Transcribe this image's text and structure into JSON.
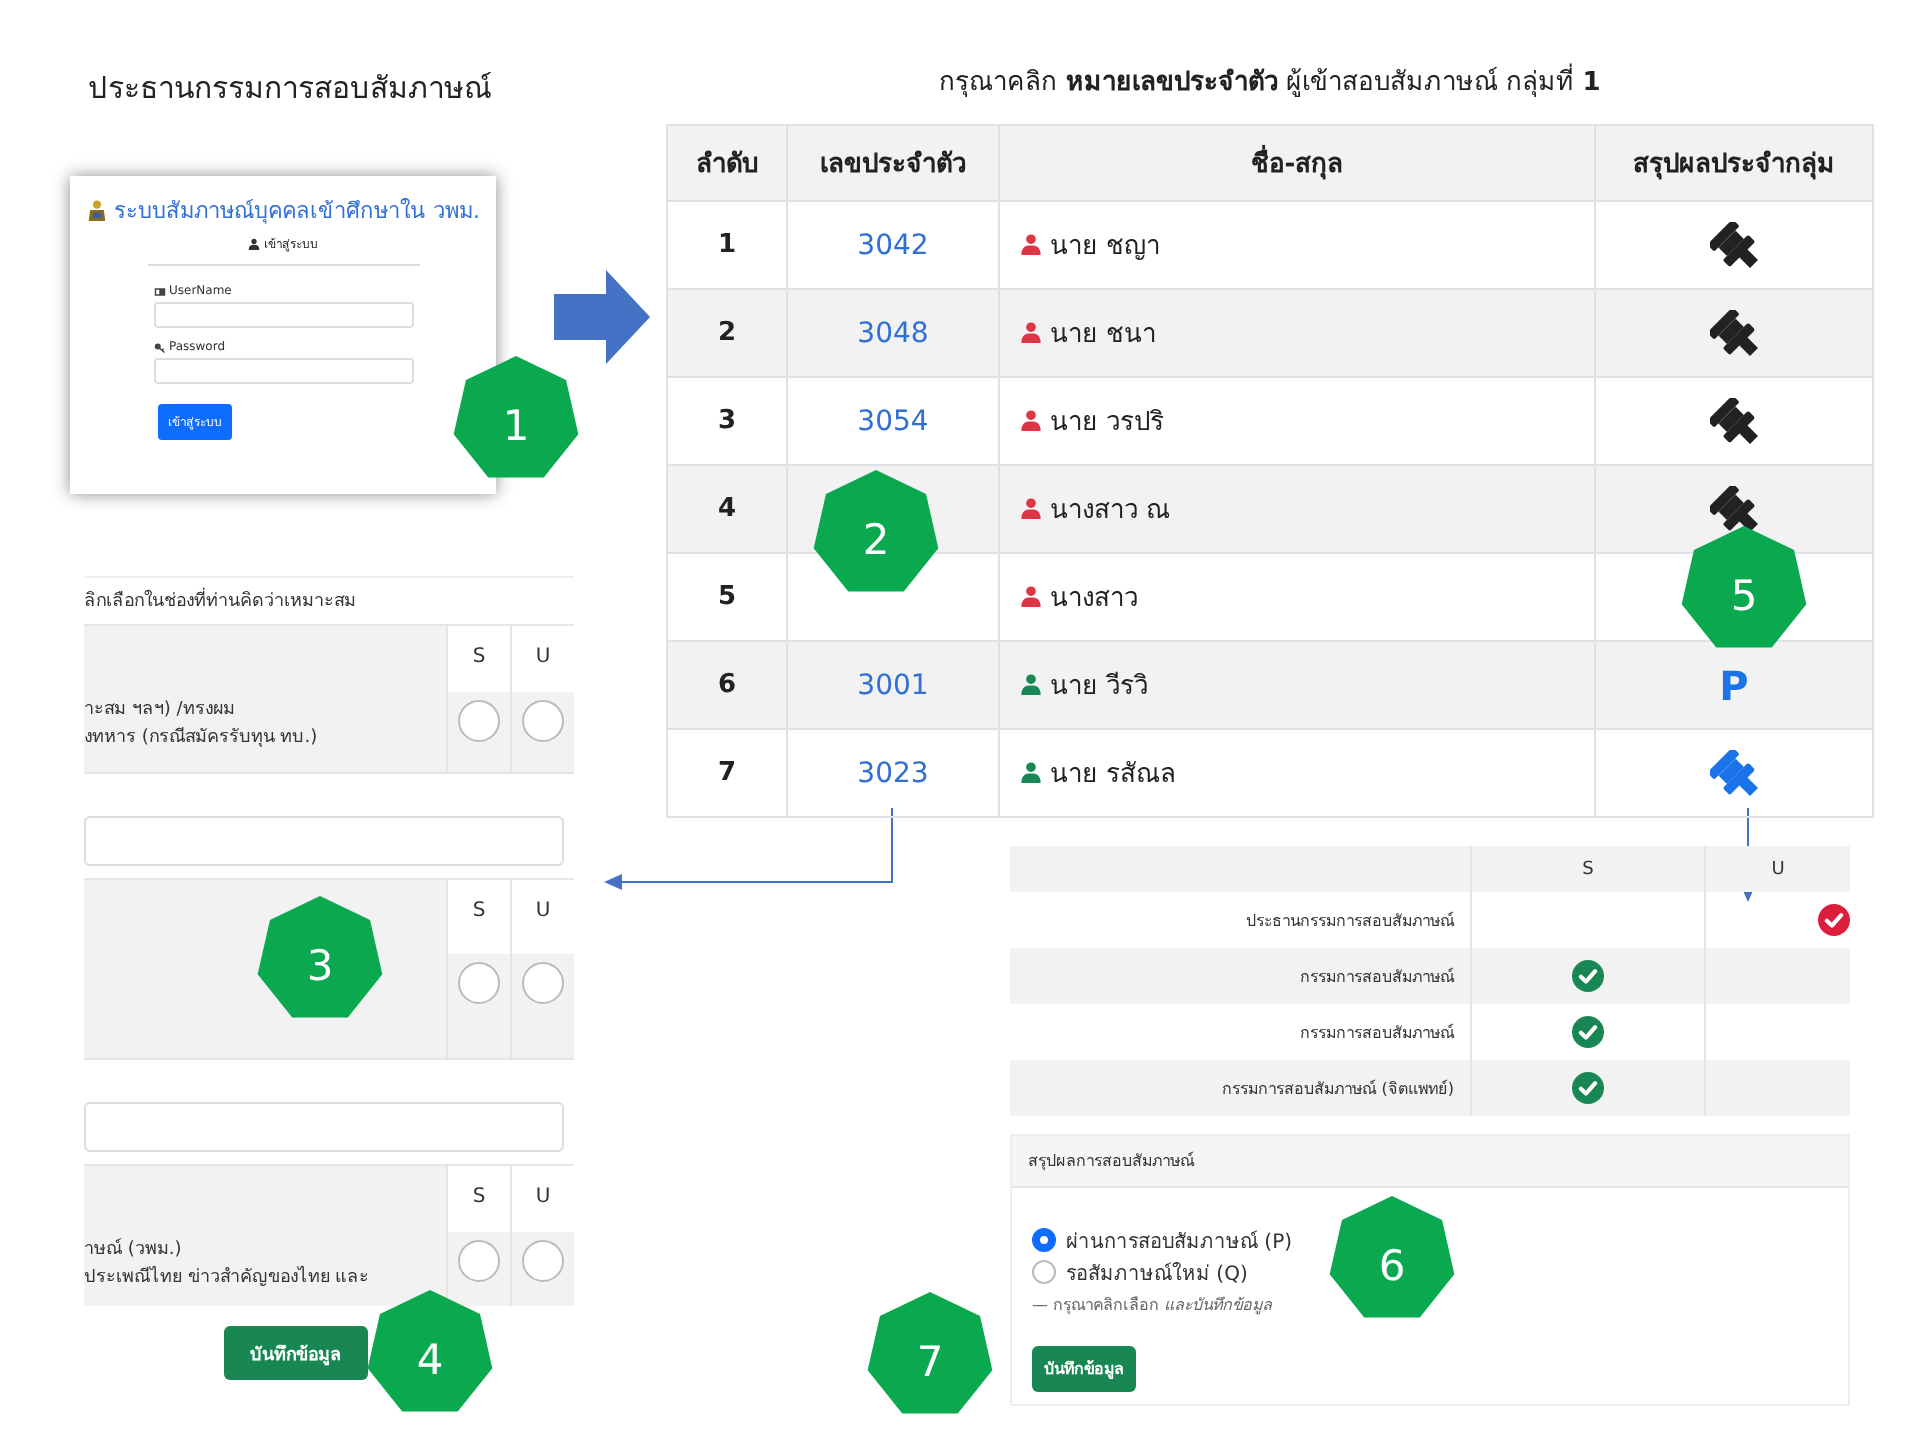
{
  "slide_title": "ประธานกรรมการสอบสัมภาษณ์",
  "login_screen": {
    "title": "ระบบสัมภาษณ์บุคคลเข้าศึกษาใน วพม.",
    "subtitle": "เข้าสู่ระบบ",
    "fields": [
      {
        "kind": "user",
        "label": "UserName"
      },
      {
        "kind": "password",
        "label": "Password"
      }
    ],
    "button": "เข้าสู่ระบบ"
  },
  "student_table": {
    "caption": "กรุณาคลิก **หมายเลขประจำตัว** ผู้เข้าสอบสัมภาษณ์ กลุ่มที่ **1**",
    "columns": [
      "ลำดับ",
      "เลขประจำตัว",
      "ชื่อ-สกุล",
      "สรุปผลประจำกลุ่ม"
    ],
    "rows": [
      {
        "no": "1",
        "id": "3042",
        "name": "นาย ชญา",
        "color": "#dc3545",
        "result": {
          "kind": "gavel",
          "active": false
        }
      },
      {
        "no": "2",
        "id": "3048",
        "name": "นาย ชนา",
        "color": "#dc3545",
        "result": {
          "kind": "gavel",
          "active": false
        }
      },
      {
        "no": "3",
        "id": "3054",
        "name": "นาย วรปริ",
        "color": "#dc3545",
        "result": {
          "kind": "gavel",
          "active": false
        }
      },
      {
        "no": "4",
        "name": "นางสาว ณ",
        "color": "#dc3545",
        "result": {
          "kind": "gavel",
          "active": false
        }
      },
      {
        "no": "5",
        "name": "นางสาว",
        "color": "#dc3545"
      },
      {
        "no": "6",
        "id": "3001",
        "name": "นาย วีรวิ",
        "color": "#198754",
        "result": {
          "kind": "label",
          "text": "P"
        }
      },
      {
        "no": "7",
        "id": "3023",
        "name": "นาย รสัณล",
        "color": "#198754",
        "result": {
          "kind": "gavel",
          "active": true
        }
      }
    ]
  },
  "assessment_form": {
    "instruction": "ลิกเลือกในช่องที่ท่านคิดว่าเหมาะสม",
    "items": [
      {
        "kind": "criterion",
        "lines": [
          "าะสม ฯลฯ) /ทรงผม",
          "งทหาร (กรณีสมัครรับทุน ทบ.)"
        ],
        "choices": [
          {
            "label": "S",
            "checked": false
          },
          {
            "label": "U",
            "checked": false
          }
        ]
      },
      {
        "kind": "comment"
      },
      {
        "kind": "criterion",
        "choices": [
          {
            "label": "S",
            "checked": false
          },
          {
            "label": "U",
            "checked": false
          }
        ]
      },
      {
        "kind": "comment"
      },
      {
        "kind": "criterion",
        "lines": [
          "าษณ์ (วพม.)",
          "ประเพณีไทย ข่าวสำคัญของไทย และ"
        ],
        "choices": [
          {
            "label": "S",
            "checked": false
          },
          {
            "label": "U",
            "checked": false
          }
        ]
      }
    ],
    "save_button": "บันทึกข้อมูล"
  },
  "committee_table": {
    "columns": [
      "S",
      "U"
    ],
    "rows": [
      {
        "role": "ประธานกรรมการสอบสัมภาษณ์",
        "votes": [
          {
            "checked": false
          },
          {
            "checked": true
          }
        ]
      },
      {
        "role": "กรรมการสอบสัมภาษณ์",
        "votes": [
          {
            "checked": true
          },
          {
            "checked": false
          }
        ]
      },
      {
        "role": "กรรมการสอบสัมภาษณ์",
        "votes": [
          {
            "checked": true
          },
          {
            "checked": false
          }
        ]
      },
      {
        "role": "กรรมการสอบสัมภาษณ์ (จิตแพทย์)",
        "votes": [
          {
            "checked": true
          },
          {
            "checked": false
          }
        ]
      }
    ]
  },
  "summary_card": {
    "title": "สรุปผลการสอบสัมภาษณ์",
    "options": [
      {
        "label": "ผ่านการสอบสัมภาษณ์ (P)",
        "selected": true
      },
      {
        "label": "รอสัมภาษณ์ใหม่ (Q)",
        "selected": false
      }
    ],
    "hint": "— กรุณาคลิกเลือก *และบันทึกข้อมูล*",
    "button": "บันทึกข้อมูล"
  },
  "step_badges": [
    "1",
    "2",
    "3",
    "4",
    "5",
    "6",
    "7"
  ]
}
